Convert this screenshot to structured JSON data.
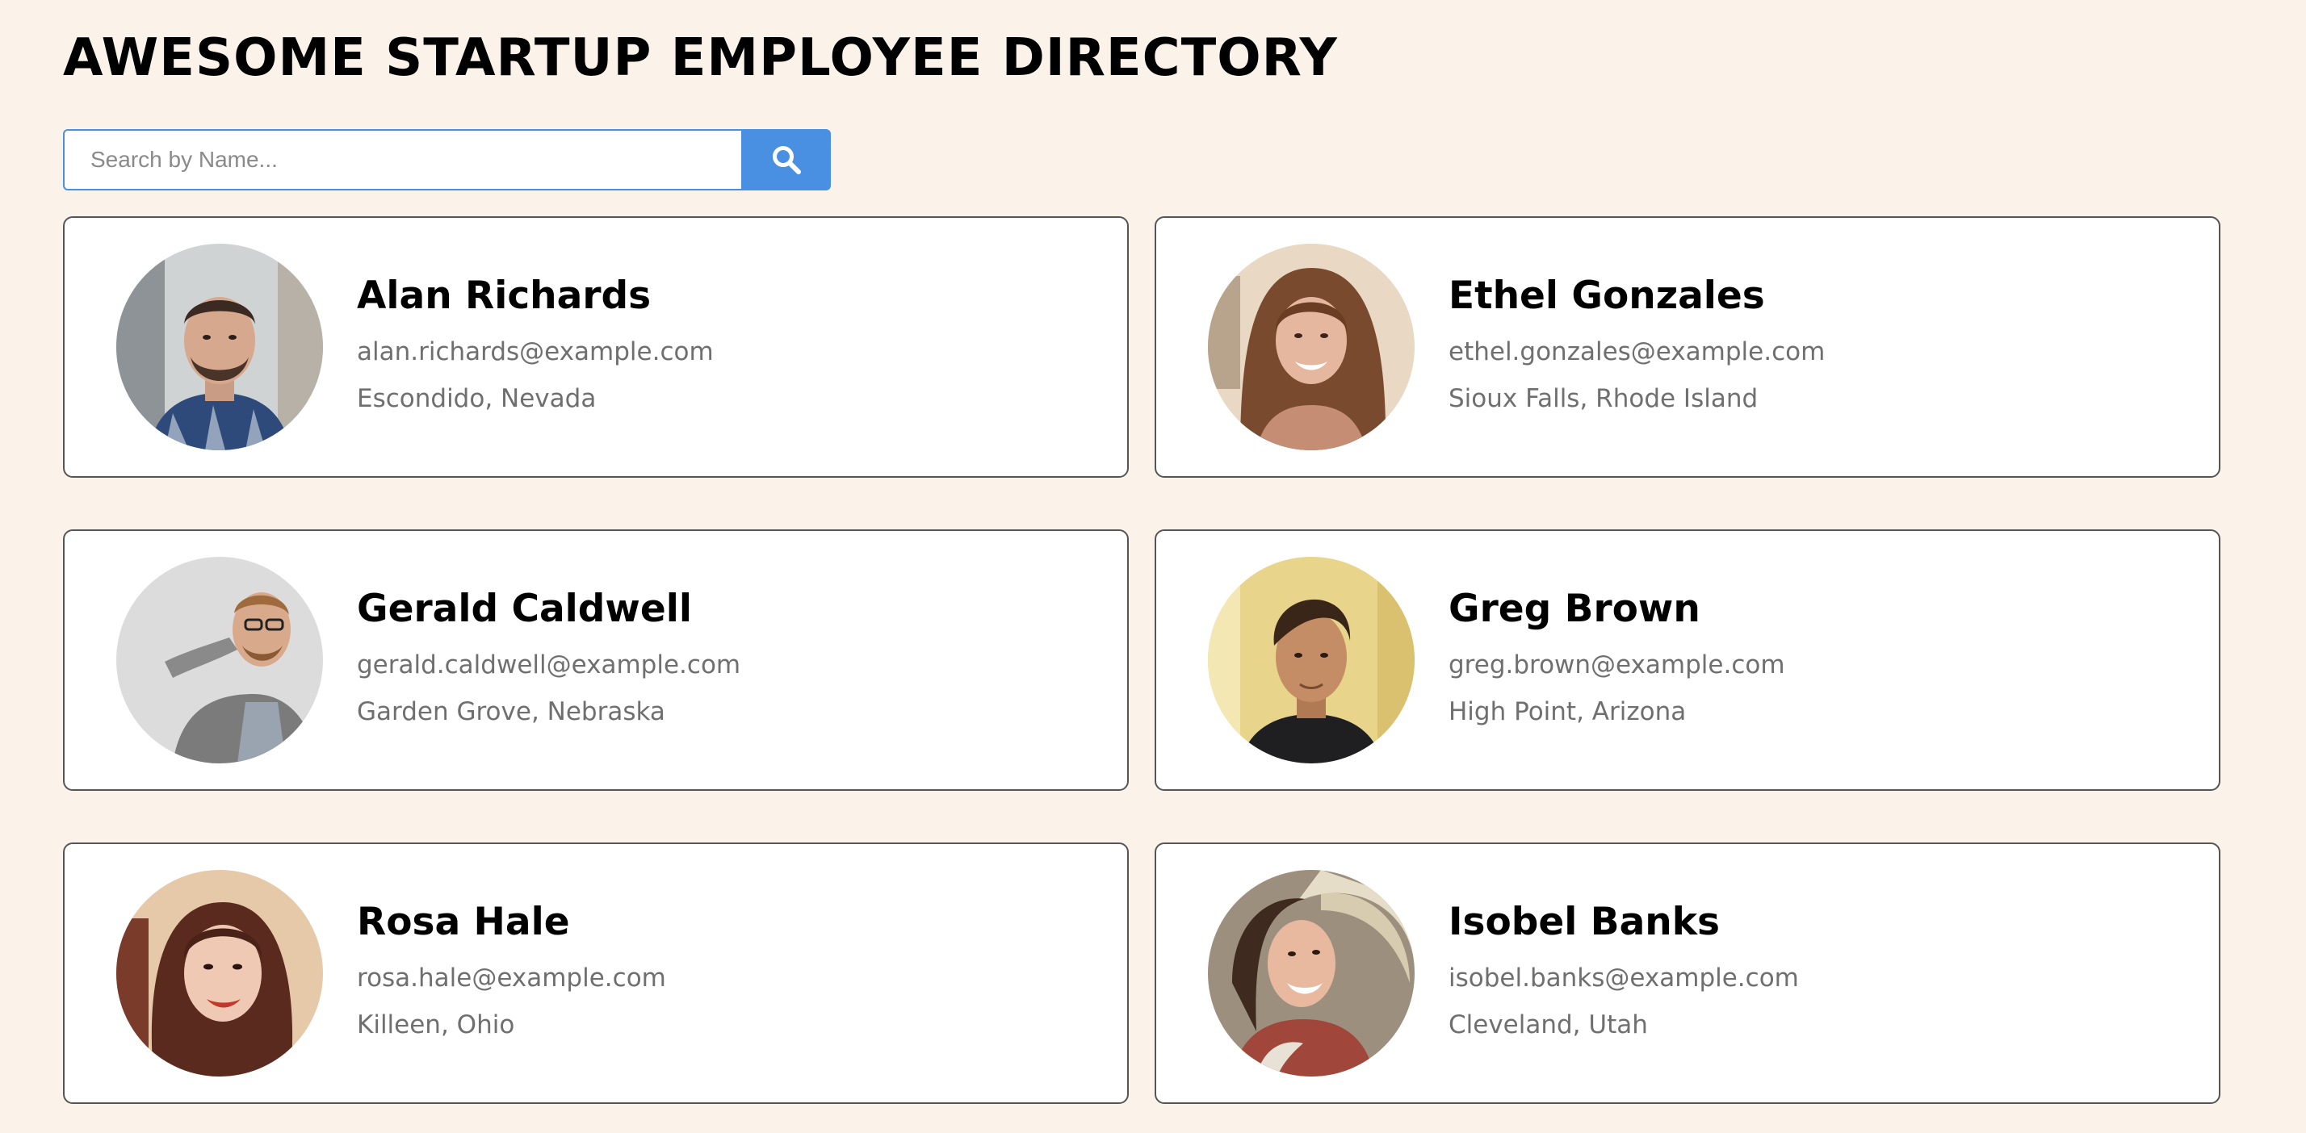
{
  "header": {
    "title": "AWESOME STARTUP EMPLOYEE DIRECTORY"
  },
  "search": {
    "placeholder": "Search by Name...",
    "value": "",
    "button_icon": "search-icon",
    "accent_color": "#4a90e2"
  },
  "employees": [
    {
      "name": "Alan Richards",
      "email": "alan.richards@example.com",
      "location": "Escondido, Nevada",
      "avatar": "avatar-man-beard-plaid"
    },
    {
      "name": "Ethel Gonzales",
      "email": "ethel.gonzales@example.com",
      "location": "Sioux Falls, Rhode Island",
      "avatar": "avatar-woman-curly-hair"
    },
    {
      "name": "Gerald Caldwell",
      "email": "gerald.caldwell@example.com",
      "location": "Garden Grove, Nebraska",
      "avatar": "avatar-man-glasses-cardigan"
    },
    {
      "name": "Greg Brown",
      "email": "greg.brown@example.com",
      "location": "High Point, Arizona",
      "avatar": "avatar-man-dark-hair"
    },
    {
      "name": "Rosa Hale",
      "email": "rosa.hale@example.com",
      "location": "Killeen, Ohio",
      "avatar": "avatar-woman-brown-hair"
    },
    {
      "name": "Isobel Banks",
      "email": "isobel.banks@example.com",
      "location": "Cleveland, Utah",
      "avatar": "avatar-woman-sunhat"
    }
  ]
}
